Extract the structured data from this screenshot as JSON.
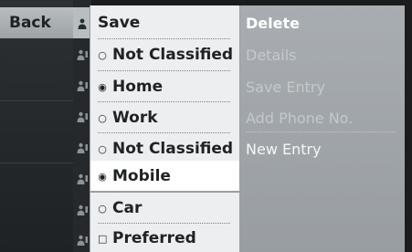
{
  "back_button": {
    "label": "Back"
  },
  "menu": {
    "items": [
      {
        "label": "Save",
        "bullet": "",
        "selected": false
      },
      {
        "label": "Not Classified",
        "bullet": "○",
        "selected": false
      },
      {
        "label": "Home",
        "bullet": "◉",
        "selected": false
      },
      {
        "label": "Work",
        "bullet": "○",
        "selected": false
      },
      {
        "label": "Not Classified",
        "bullet": "○",
        "selected": false
      },
      {
        "label": "Mobile",
        "bullet": "◉",
        "selected": true
      },
      {
        "label": "Car",
        "bullet": "○",
        "selected": false
      },
      {
        "label": "Preferred",
        "bullet": "□",
        "selected": false
      }
    ]
  },
  "submenu": {
    "items": [
      {
        "label": "Delete",
        "state": "normal"
      },
      {
        "label": "Details",
        "state": "disabled"
      },
      {
        "label": "Save Entry",
        "state": "disabled"
      },
      {
        "label": "Add Phone No.",
        "state": "disabled"
      },
      {
        "label": "New Entry",
        "state": "normal"
      }
    ]
  },
  "icons": {
    "contact": "person-icon"
  },
  "colors": {
    "panel_bg": "#eceeef",
    "selected_bg": "#ffffff",
    "submenu_bg": "#a8adb1",
    "dark_bg": "#1f2224"
  }
}
